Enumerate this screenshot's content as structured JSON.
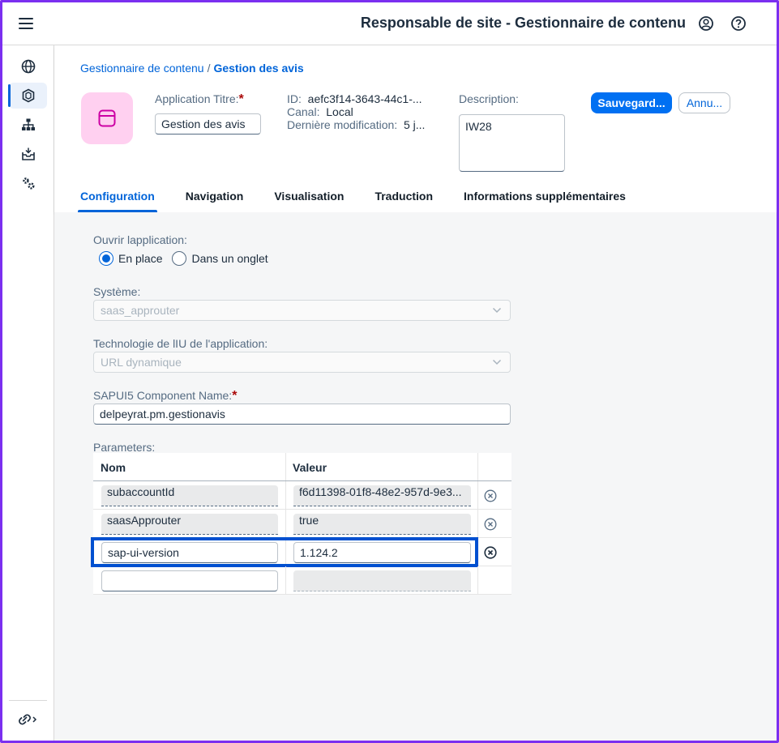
{
  "shell": {
    "title": "Responsable de site - Gestionnaire de contenu",
    "icons": [
      "menu-icon",
      "user-profile-icon",
      "help-icon"
    ]
  },
  "sidebar": {
    "items": [
      {
        "icon": "globe-icon",
        "active": false
      },
      {
        "icon": "content-manager-icon",
        "active": true
      },
      {
        "icon": "site-hierarchy-icon",
        "active": false
      },
      {
        "icon": "inbox-icon",
        "active": false
      },
      {
        "icon": "settings-gears-icon",
        "active": false
      }
    ],
    "bottom_icon": "link-expand-icon"
  },
  "breadcrumb": {
    "parent": "Gestionnaire de contenu",
    "separator": "/",
    "current": "Gestion des avis"
  },
  "header": {
    "avatar_icon": "app-window-icon",
    "title_label": "Application Titre:",
    "title_value": "Gestion des avis",
    "required_mark": "*",
    "id_label": "ID:",
    "id_value": "aefc3f14-3643-44c1-...",
    "channel_label": "Canal:",
    "channel_value": "Local",
    "modified_label": "Dernière modification:",
    "modified_value": "5 j...",
    "description_label": "Description:",
    "description_value": "IW28",
    "save_label": "Sauvegard...",
    "cancel_label": "Annu..."
  },
  "tabs": [
    {
      "label": "Configuration",
      "active": true
    },
    {
      "label": "Navigation",
      "active": false
    },
    {
      "label": "Visualisation",
      "active": false
    },
    {
      "label": "Traduction",
      "active": false
    },
    {
      "label": "Informations supplémentaires",
      "active": false
    }
  ],
  "form": {
    "open_label": "Ouvrir lapplication:",
    "open_options": [
      {
        "label": "En place",
        "checked": true
      },
      {
        "label": "Dans un onglet",
        "checked": false
      }
    ],
    "system_label": "Système:",
    "system_value": "saas_approuter",
    "tech_label": "Technologie de lIU de l'application:",
    "tech_value": "URL dynamique",
    "component_label": "SAPUI5 Component Name:",
    "component_required": "*",
    "component_value": "delpeyrat.pm.gestionavis",
    "parameters_label": "Parameters:"
  },
  "parameters": {
    "headers": {
      "name": "Nom",
      "value": "Valeur"
    },
    "rows": [
      {
        "name": "subaccountId",
        "value": "f6d11398-01f8-48e2-957d-9e3...",
        "editable": false,
        "deletable": true,
        "highlighted": false
      },
      {
        "name": "saasApprouter",
        "value": "true",
        "editable": false,
        "deletable": true,
        "highlighted": false
      },
      {
        "name": "sap-ui-version",
        "value": "1.124.2",
        "editable": true,
        "deletable": true,
        "highlighted": true
      },
      {
        "name": "",
        "value": "",
        "editable": "name-only",
        "deletable": false,
        "highlighted": false
      }
    ]
  },
  "colors": {
    "accent": "#0064d9",
    "button": "#0070f2",
    "frame": "#7b2ff0",
    "highlight": "#0050d0",
    "avatar_bg": "#ffd0f0",
    "avatar_icon": "#cc00a3"
  }
}
